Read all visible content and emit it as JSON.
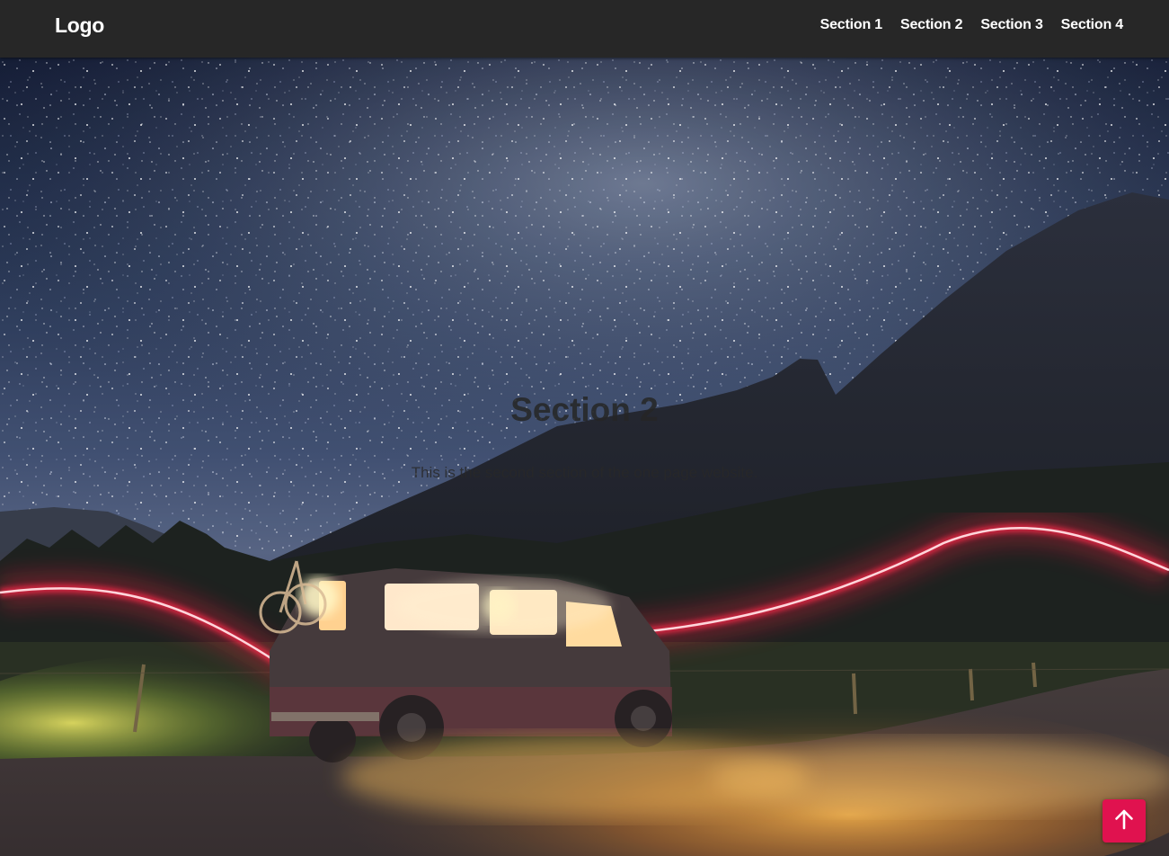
{
  "header": {
    "logo": "Logo",
    "nav": [
      {
        "label": "Section 1"
      },
      {
        "label": "Section 2"
      },
      {
        "label": "Section 3"
      },
      {
        "label": "Section 4"
      }
    ]
  },
  "hero": {
    "title": "Section 2",
    "text": "This is the second section of the one page website.",
    "background": "night-sky-van-mountain-photo"
  },
  "back_to_top": {
    "icon": "arrow-up-icon",
    "color": "#e0124f"
  },
  "colors": {
    "navbar": "#272727",
    "accent": "#e0124f"
  }
}
